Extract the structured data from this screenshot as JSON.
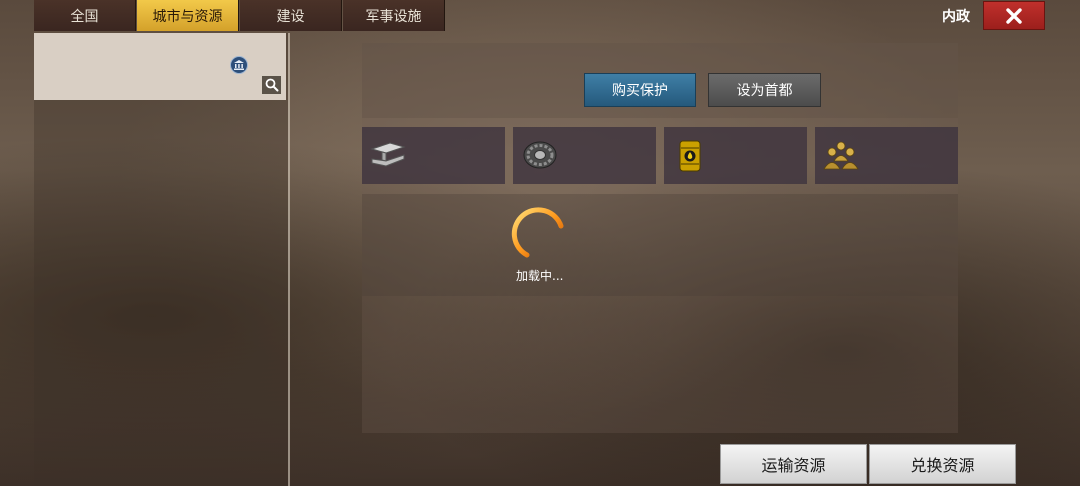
{
  "tabs": [
    {
      "label": "全国",
      "active": false
    },
    {
      "label": "城市与资源",
      "active": true
    },
    {
      "label": "建设",
      "active": false
    },
    {
      "label": "军事设施",
      "active": false
    }
  ],
  "header": {
    "title": "内政",
    "close_icon": "close-icon"
  },
  "city_list": {
    "badge_icon": "capitol-building-icon",
    "search_icon": "search-icon"
  },
  "actions": {
    "buy_protection": "购买保护",
    "set_capital": "设为首都"
  },
  "resources": [
    {
      "icon": "steel-beam-icon"
    },
    {
      "icon": "tire-icon"
    },
    {
      "icon": "oil-barrel-icon"
    },
    {
      "icon": "population-icon"
    }
  ],
  "loading": {
    "text": "加载中..."
  },
  "bottom": {
    "transport": "运输资源",
    "exchange": "兑换资源"
  },
  "colors": {
    "active_tab": "#e8b63a",
    "close": "#b02a26",
    "protect_button": "#2f6a90"
  }
}
